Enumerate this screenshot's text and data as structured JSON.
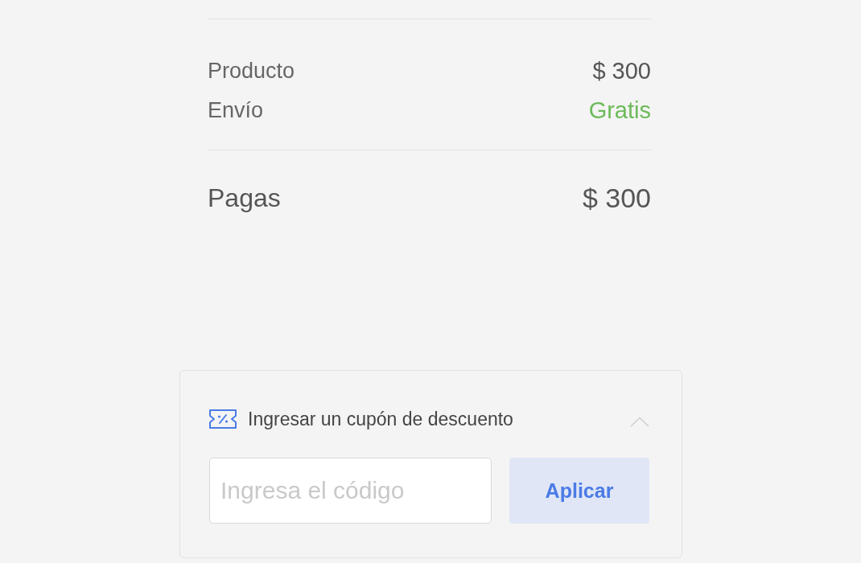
{
  "summary": {
    "rows": [
      {
        "label": "Producto",
        "value": "$ 300",
        "kind": "price"
      },
      {
        "label": "Envío",
        "value": "Gratis",
        "kind": "free"
      }
    ],
    "total": {
      "label": "Pagas",
      "value": "$ 300"
    }
  },
  "coupon": {
    "title": "Ingresar un cupón de descuento",
    "expanded": true,
    "input": {
      "placeholder": "Ingresa el código"
    },
    "button": "Aplicar"
  }
}
